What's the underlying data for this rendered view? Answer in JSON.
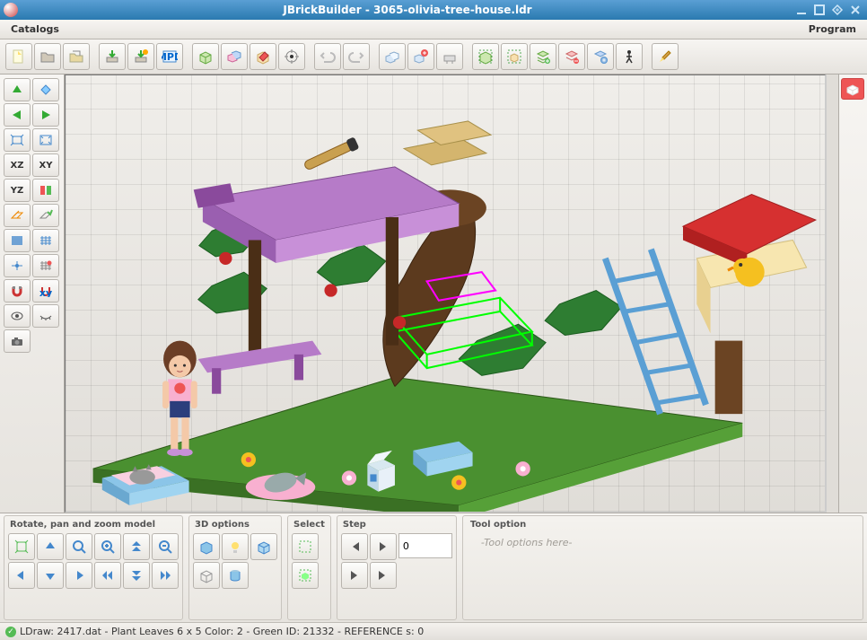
{
  "window": {
    "title": "JBrickBuilder - 3065-olivia-tree-house.ldr"
  },
  "menu": {
    "catalogs": "Catalogs",
    "program": "Program"
  },
  "toolbar_icons": [
    "new-file",
    "open-file",
    "recent",
    "import",
    "import-mpd",
    "mpd",
    "box-add",
    "box-multi",
    "box-edit",
    "target",
    "undo",
    "redo",
    "copy",
    "paste-special",
    "cut",
    "select-all",
    "select-add",
    "layer-add",
    "layer-edit",
    "layer-color",
    "walk",
    "brush"
  ],
  "left_tools": [
    [
      "arrow-up",
      "diamond"
    ],
    [
      "arrow-left",
      "arrow-right"
    ],
    [
      "fit",
      "fit-all"
    ],
    [
      "xz",
      "xy"
    ],
    [
      "yz",
      "color-toggle"
    ],
    [
      "grid-plane",
      "grid-check"
    ],
    [
      "grid-fine",
      "grid-coarse"
    ],
    [
      "snap-center",
      "snap-red"
    ],
    [
      "magnet",
      "magnet-xy"
    ],
    [
      "eye-open",
      "eye-closed"
    ],
    [
      "camera",
      ""
    ]
  ],
  "left_labels": {
    "xz": "XZ",
    "xy": "XY",
    "yz": "YZ"
  },
  "bottom": {
    "rotate_title": "Rotate, pan and zoom model",
    "options3d_title": "3D options",
    "select_title": "Select",
    "step_title": "Step",
    "step_value": "0",
    "tool_option_title": "Tool option",
    "tool_option_placeholder": "-Tool options here-"
  },
  "status": {
    "text": "LDraw: 2417.dat - Plant Leaves  6 x  5 Color: 2 - Green ID: 21332 - REFERENCE s: 0"
  }
}
